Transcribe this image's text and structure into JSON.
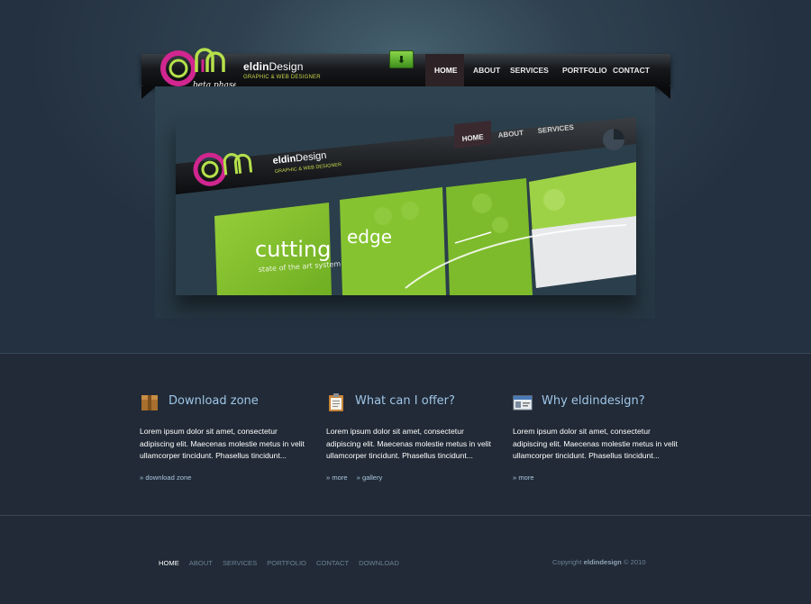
{
  "brand": {
    "name_bold": "eldin",
    "name_rest": "Design",
    "tagline": "GRAPHIC & WEB DESIGNER",
    "logo_text": "beta phase"
  },
  "nav": {
    "items": [
      "HOME",
      "ABOUT",
      "SERVICES",
      "PORTFOLIO",
      "CONTACT"
    ],
    "active": "HOME"
  },
  "download_icon": "download-arrow-icon",
  "slider": {
    "nav_items": [
      "HOME",
      "ABOUT",
      "SERVICES"
    ],
    "brand_name_bold": "eldin",
    "brand_name_rest": "Design",
    "brand_tagline": "GRAPHIC & WEB DESIGNER",
    "headline_a": "cutting",
    "headline_b": "edge",
    "subline": "state of the art system"
  },
  "columns": [
    {
      "icon": "box-icon",
      "title": "Download zone",
      "text": "Lorem ipsum dolor sit amet, consectetur adipiscing elit. Maecenas molestie metus in velit ullamcorper tincidunt. Phasellus tincidunt...",
      "links": [
        "» download zone"
      ]
    },
    {
      "icon": "clipboard-icon",
      "title": "What can I offer?",
      "text": "Lorem ipsum dolor sit amet, consectetur adipiscing elit. Maecenas molestie metus in velit ullamcorper tincidunt. Phasellus tincidunt...",
      "links": [
        "» more",
        "» gallery"
      ]
    },
    {
      "icon": "id-card-icon",
      "title": "Why eldindesign?",
      "text": "Lorem ipsum dolor sit amet, consectetur adipiscing elit. Maecenas molestie metus in velit ullamcorper tincidunt. Phasellus tincidunt...",
      "links": [
        "» more"
      ]
    }
  ],
  "footer": {
    "nav": [
      "HOME",
      "ABOUT",
      "SERVICES",
      "PORTFOLIO",
      "CONTACT",
      "DOWNLOAD"
    ],
    "active": "HOME",
    "copyright_pre": "Copyright",
    "copyright_brand": "eldindesign",
    "copyright_post": "© 2010"
  },
  "colors": {
    "accent_green": "#8cc63f",
    "logo_magenta": "#d1268f",
    "logo_lime": "#b6e04a",
    "title_blue": "#9fc6e8"
  }
}
